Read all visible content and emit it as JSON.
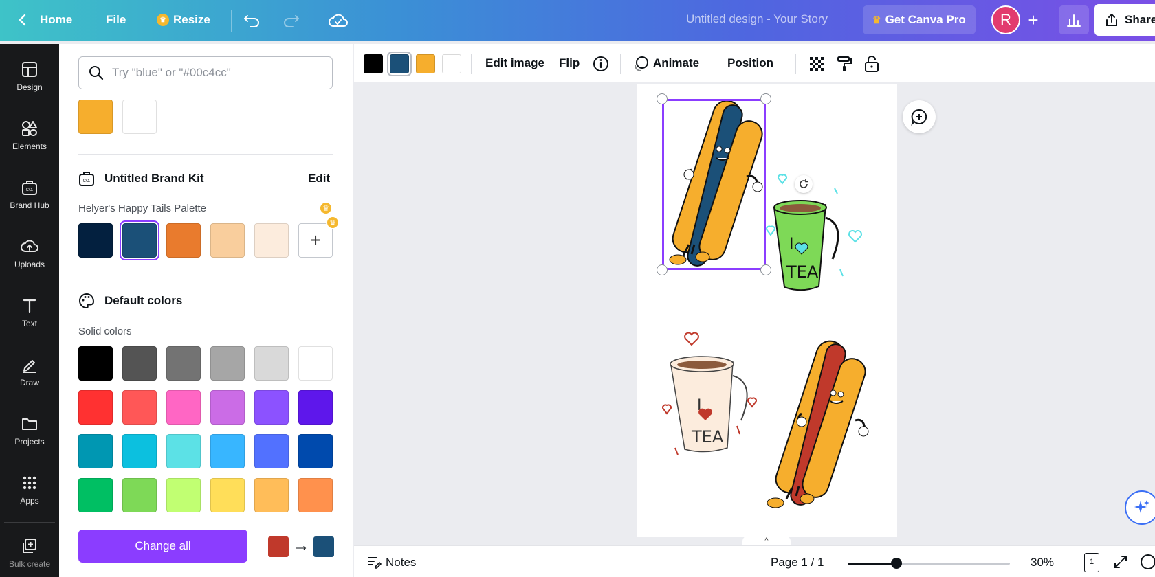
{
  "topbar": {
    "home": "Home",
    "file": "File",
    "resize": "Resize",
    "design_title": "Untitled design - Your Story",
    "get_pro": "Get Canva Pro",
    "avatar_initial": "R",
    "share": "Share"
  },
  "rail": {
    "items": [
      {
        "label": "Design",
        "icon": "design-icon"
      },
      {
        "label": "Elements",
        "icon": "elements-icon"
      },
      {
        "label": "Brand Hub",
        "icon": "brand-hub-icon"
      },
      {
        "label": "Uploads",
        "icon": "uploads-icon"
      },
      {
        "label": "Text",
        "icon": "text-icon"
      },
      {
        "label": "Draw",
        "icon": "draw-icon"
      },
      {
        "label": "Projects",
        "icon": "projects-icon"
      },
      {
        "label": "Apps",
        "icon": "apps-icon"
      },
      {
        "label": "Bulk create",
        "icon": "bulk-create-icon"
      }
    ]
  },
  "panel": {
    "search_placeholder": "Try \"blue\" or \"#00c4cc\"",
    "document_colors": [
      "#f6ae2d",
      "#ffffff"
    ],
    "brand_kit": {
      "title": "Untitled Brand Kit",
      "edit": "Edit",
      "palette_name": "Helyer's Happy Tails Palette",
      "colors": [
        "#03203f",
        "#1b5078",
        "#e97b2d",
        "#f9ce9d",
        "#fcecdd"
      ],
      "selected_index": 1
    },
    "default_colors": {
      "title": "Default colors",
      "subtitle": "Solid colors",
      "rows": [
        [
          "#000000",
          "#545454",
          "#737373",
          "#a6a6a6",
          "#d9d9d9",
          "#ffffff"
        ],
        [
          "#ff3131",
          "#ff5757",
          "#ff66c4",
          "#cb6ce6",
          "#8c52ff",
          "#5e17eb"
        ],
        [
          "#0097b2",
          "#0cc0df",
          "#5ce1e6",
          "#38b6ff",
          "#5271ff",
          "#004aad"
        ],
        [
          "#00bf63",
          "#7ed957",
          "#c1ff72",
          "#ffde59",
          "#ffbd59",
          "#ff914d"
        ]
      ]
    },
    "change_all": {
      "label": "Change all",
      "from": "#c0392b",
      "to": "#1b5078"
    }
  },
  "toolbar": {
    "colors": [
      "#000000",
      "#1b5078",
      "#f6ae2d",
      "#ffffff"
    ],
    "selected_index": 1,
    "edit_image": "Edit image",
    "flip": "Flip",
    "animate": "Animate",
    "position": "Position"
  },
  "footer": {
    "notes": "Notes",
    "page": "Page 1 / 1",
    "zoom": "30%",
    "zoom_level": 0.3,
    "page_count": "1"
  }
}
